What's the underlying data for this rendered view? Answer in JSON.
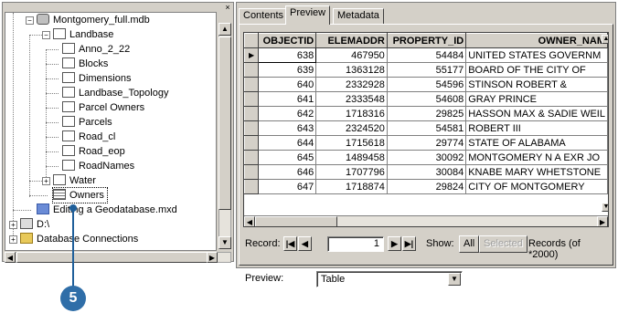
{
  "tree": {
    "close_glyph": "×",
    "nodes": [
      {
        "label": "Montgomery_full.mdb",
        "icon": "database-icon"
      },
      {
        "label": "Landbase",
        "icon": "feature-dataset-icon"
      },
      {
        "label": "Anno_2_22",
        "icon": "annotation-class-icon"
      },
      {
        "label": "Blocks",
        "icon": "polygon-class-icon"
      },
      {
        "label": "Dimensions",
        "icon": "dimension-class-icon"
      },
      {
        "label": "Landbase_Topology",
        "icon": "topology-icon"
      },
      {
        "label": "Parcel Owners",
        "icon": "relationship-class-icon"
      },
      {
        "label": "Parcels",
        "icon": "polygon-class-icon"
      },
      {
        "label": "Road_cl",
        "icon": "line-class-icon"
      },
      {
        "label": "Road_eop",
        "icon": "line-class-icon"
      },
      {
        "label": "RoadNames",
        "icon": "annotation-class-icon"
      },
      {
        "label": "Water",
        "icon": "feature-dataset-icon"
      },
      {
        "label": "Owners",
        "icon": "table-icon"
      },
      {
        "label": "Editing a Geodatabase.mxd",
        "icon": "map-document-icon"
      },
      {
        "label": "D:\\",
        "icon": "drive-icon"
      },
      {
        "label": "Database Connections",
        "icon": "folder-icon"
      }
    ]
  },
  "callout": {
    "number": "5"
  },
  "tabs": [
    {
      "label": "Contents"
    },
    {
      "label": "Preview"
    },
    {
      "label": "Metadata"
    }
  ],
  "table": {
    "columns": [
      "OBJECTID",
      "ELEMADDR",
      "PROPERTY_ID",
      "OWNER_NAM"
    ],
    "rows": [
      [
        "638",
        "467950",
        "54484",
        "UNITED STATES GOVERNM"
      ],
      [
        "639",
        "1363128",
        "55177",
        "BOARD OF THE CITY OF"
      ],
      [
        "640",
        "2332928",
        "54596",
        "STINSON ROBERT &"
      ],
      [
        "641",
        "2333548",
        "54608",
        "GRAY PRINCE"
      ],
      [
        "642",
        "1718316",
        "29825",
        "HASSON MAX & SADIE WEIL"
      ],
      [
        "643",
        "2324520",
        "54581",
        "ROBERT III"
      ],
      [
        "644",
        "1715618",
        "29774",
        "STATE OF ALABAMA"
      ],
      [
        "645",
        "1489458",
        "30092",
        "MONTGOMERY N A EXR JO"
      ],
      [
        "646",
        "1707796",
        "30084",
        "KNABE MARY WHETSTONE"
      ],
      [
        "647",
        "1718874",
        "29824",
        "CITY OF MONTGOMERY"
      ]
    ]
  },
  "record_bar": {
    "record_label": "Record:",
    "record_value": "1",
    "show_label": "Show:",
    "all_label": "All",
    "selected_label": "Selected",
    "records_label": "Records (of *2000)"
  },
  "preview": {
    "label": "Preview:",
    "value": "Table"
  }
}
